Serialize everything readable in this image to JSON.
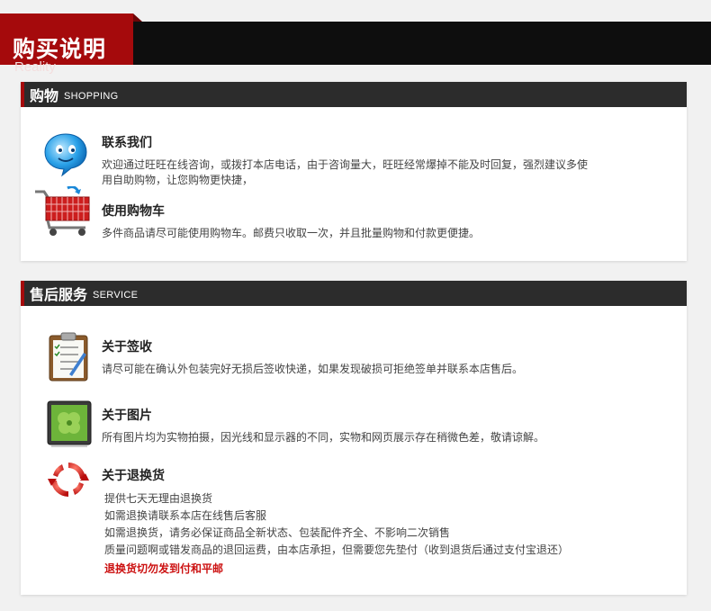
{
  "header": {
    "title": "购买说明",
    "subtitle": "Reality"
  },
  "shopping": {
    "heading_zh": "购物",
    "heading_en": "SHOPPING",
    "contact": {
      "title": "联系我们",
      "line1": "欢迎通过旺旺在线咨询，或拨打本店电话，由于咨询量大，旺旺经常爆掉不能及时回复，强烈建议多使",
      "line2": "用自助购物，让您购物更快捷，"
    },
    "cart": {
      "title": "使用购物车",
      "text": "多件商品请尽可能使用购物车。邮费只收取一次，并且批量购物和付款更便捷。"
    }
  },
  "service": {
    "heading_zh": "售后服务",
    "heading_en": "SERVICE",
    "sign": {
      "title": "关于签收",
      "text": "请尽可能在确认外包装完好无损后签收快递，如果发现破损可拒绝签单并联系本店售后。"
    },
    "photo": {
      "title": "关于图片",
      "text": "所有图片均为实物拍摄，因光线和显示器的不同，实物和网页展示存在稍微色差，敬请谅解。"
    },
    "returns": {
      "title": "关于退换货",
      "lines": [
        "提供七天无理由退换货",
        "如需退换请联系本店在线售后客服",
        "如需退换货，请务必保证商品全新状态、包装配件齐全、不影响二次销售",
        "质量问题啊或错发商品的退回运费，由本店承担，但需要您先垫付（收到退货后通过支付宝退还）"
      ],
      "warning": "退换货切勿发到付和平邮"
    }
  },
  "colors": {
    "accent": "#a50a0c",
    "dark": "#2c2c2c",
    "warning": "#cc1111"
  },
  "icons": [
    "chat-bubble-icon",
    "shopping-cart-icon",
    "clipboard-icon",
    "picture-frame-icon",
    "refresh-arrows-icon"
  ]
}
